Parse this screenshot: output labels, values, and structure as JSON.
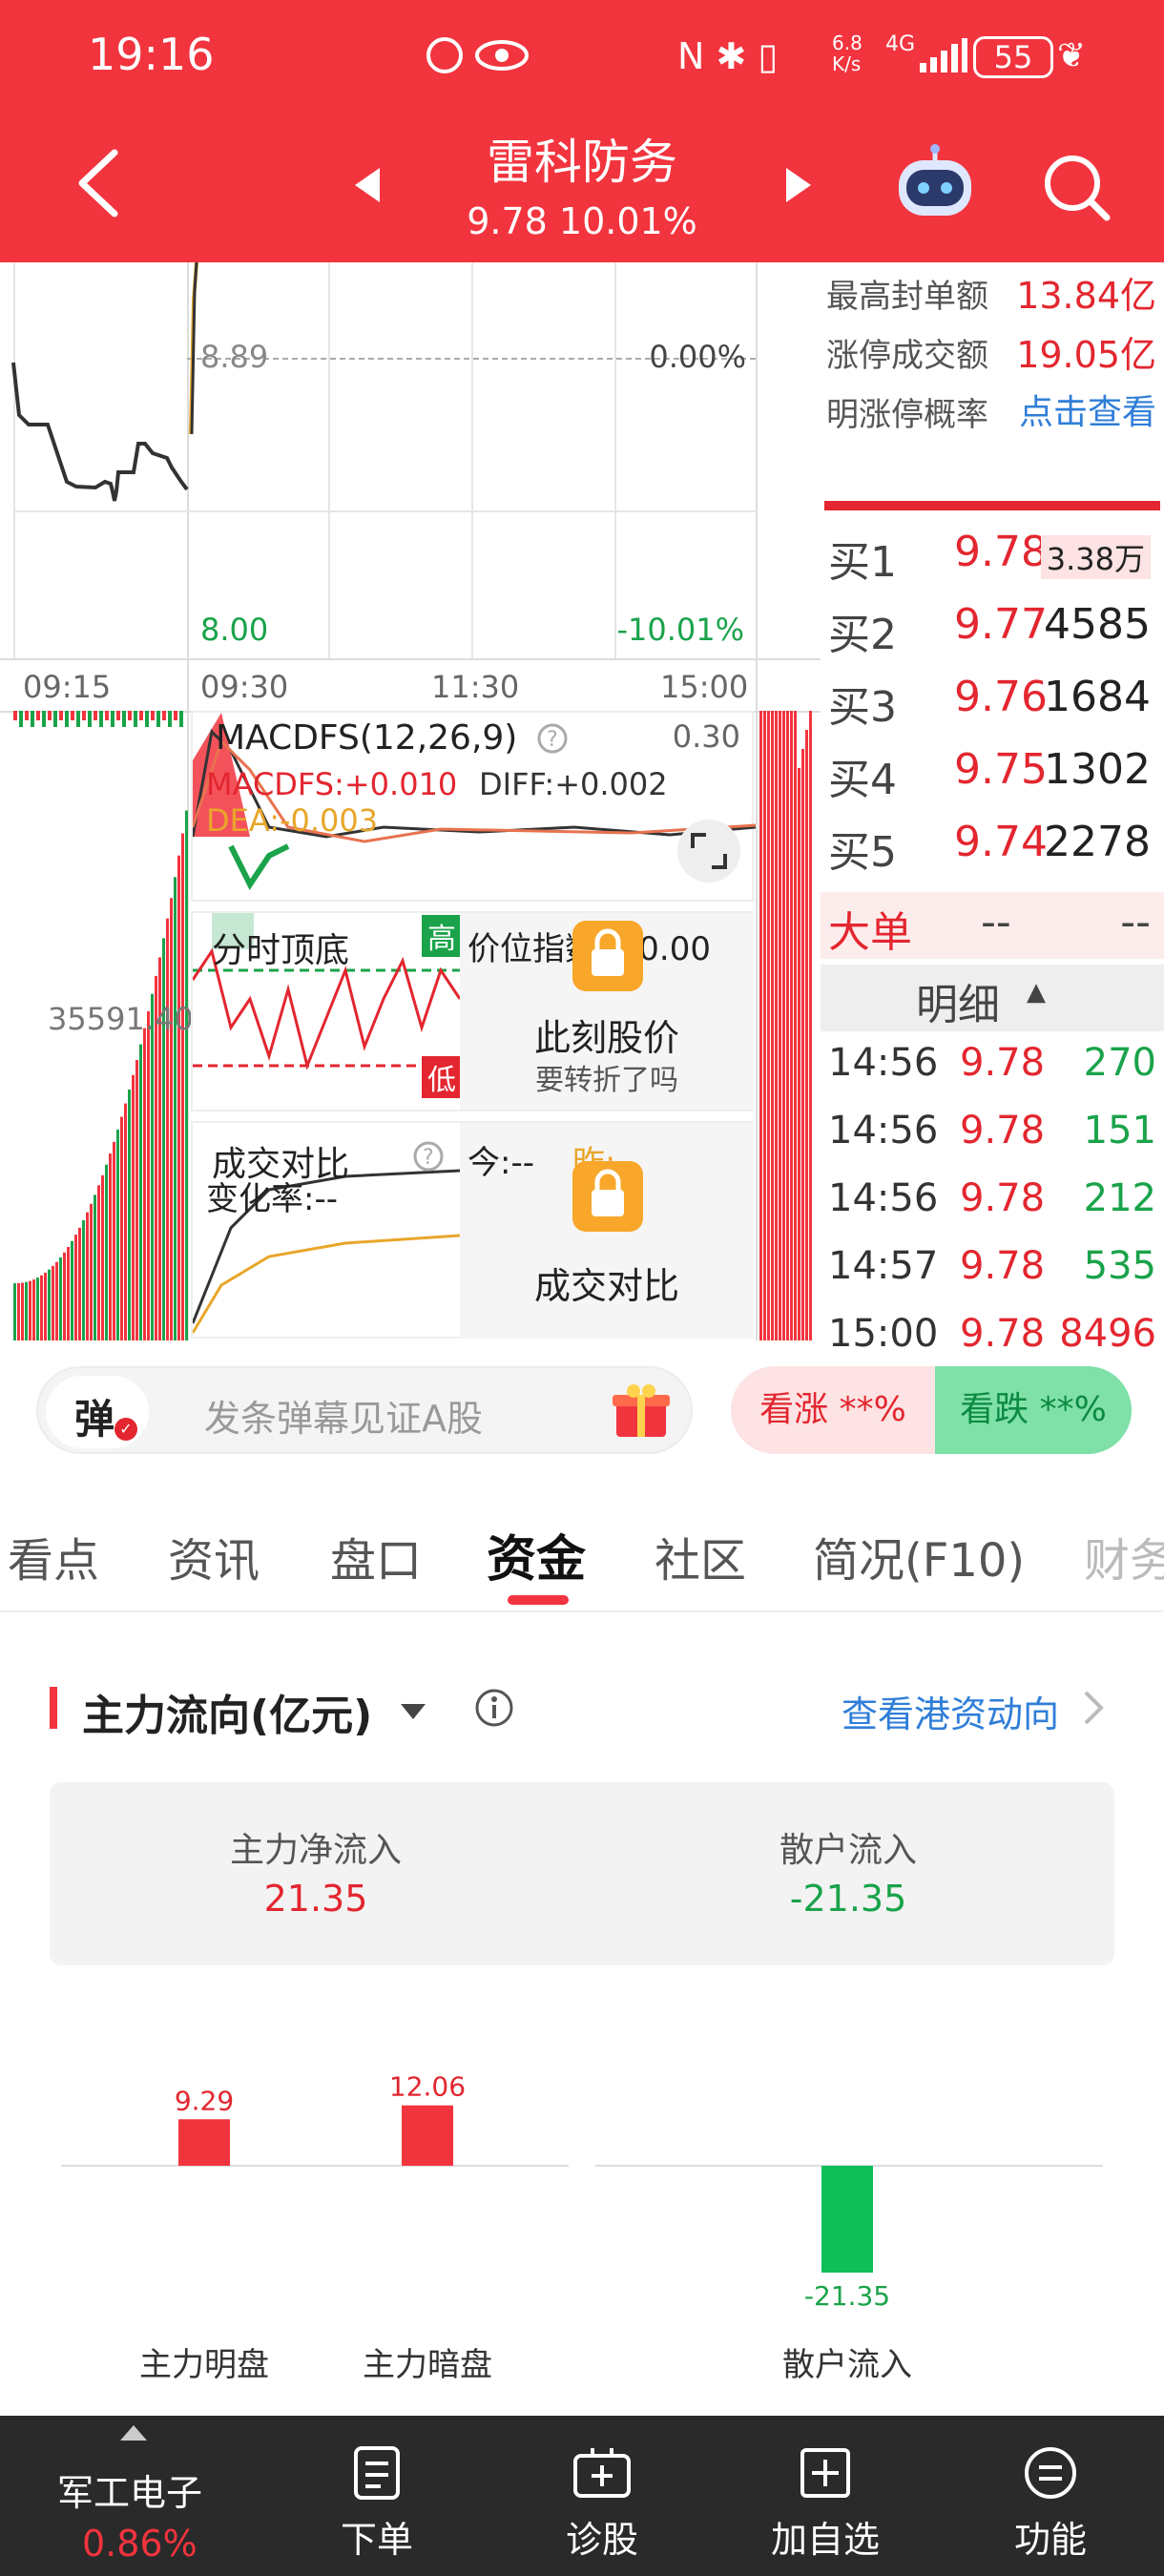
{
  "status_bar": {
    "time": "19:16",
    "net_speed": "6.8\nK/s",
    "network": "4G",
    "battery": "55"
  },
  "header": {
    "title": "雷科防务",
    "price": "9.78",
    "change_pct": "10.01%"
  },
  "chart": {
    "price_label": "8.89",
    "pct_label": "0.00%",
    "low_price": "8.00",
    "low_pct": "-10.01%",
    "time_labels": [
      "09:15",
      "09:30",
      "11:30",
      "15:00"
    ],
    "left_value": "35591.40",
    "macd": {
      "title": "MACDFS(12,26,9)",
      "max": "0.30",
      "macdfs": "MACDFS:+0.010",
      "diff": "DIFF:+0.002",
      "dea": "DEA:-0.003"
    },
    "top_bottom": {
      "title": "分时顶底",
      "high_tag": "高",
      "low_tag": "低",
      "price_index": "价位指数100.00",
      "promo_title": "此刻股价",
      "promo_sub": "要转折了吗"
    },
    "volume_compare": {
      "title": "成交对比",
      "today": "今:--",
      "yesterday": "昨:--",
      "change_rate": "变化率:--",
      "promo_title": "成交对比"
    }
  },
  "limit_info": [
    {
      "label": "最高封单额",
      "value": "13.84亿"
    },
    {
      "label": "涨停成交额",
      "value": "19.05亿"
    },
    {
      "label": "明涨停概率",
      "value": "点击查看"
    }
  ],
  "order_book": [
    {
      "label": "买1",
      "price": "9.78",
      "volume": "3.38万"
    },
    {
      "label": "买2",
      "price": "9.77",
      "volume": "4585"
    },
    {
      "label": "买3",
      "price": "9.76",
      "volume": "1684"
    },
    {
      "label": "买4",
      "price": "9.75",
      "volume": "1302"
    },
    {
      "label": "买5",
      "price": "9.74",
      "volume": "2278"
    }
  ],
  "big_order": {
    "label": "大单",
    "a": "--",
    "b": "--"
  },
  "detail": {
    "title": "明细",
    "ticks": [
      {
        "time": "14:56",
        "price": "9.78",
        "vol": "270",
        "color": "#1aa34a"
      },
      {
        "time": "14:56",
        "price": "9.78",
        "vol": "151",
        "color": "#1aa34a"
      },
      {
        "time": "14:56",
        "price": "9.78",
        "vol": "212",
        "color": "#1aa34a"
      },
      {
        "time": "14:57",
        "price": "9.78",
        "vol": "535",
        "color": "#1aa34a"
      },
      {
        "time": "15:00",
        "price": "9.78",
        "vol": "8496",
        "color": "#e3262f"
      }
    ]
  },
  "danmaku": {
    "icon_text": "弹",
    "placeholder": "发条弹幕见证A股",
    "bull": "看涨 **%",
    "bear": "看跌 **%"
  },
  "tabs": [
    "看点",
    "资讯",
    "盘口",
    "资金",
    "社区",
    "简况(F10)",
    "财务"
  ],
  "active_tab": "资金",
  "capital_flow": {
    "title": "主力流向(亿元)",
    "hk_link": "查看港资动向",
    "main_net_label": "主力净流入",
    "main_net_value": "21.35",
    "retail_label": "散户流入",
    "retail_value": "-21.35"
  },
  "chart_data": {
    "type": "bar",
    "categories": [
      "主力明盘",
      "主力暗盘",
      "散户流入"
    ],
    "values": [
      9.29,
      12.06,
      -21.35
    ],
    "value_labels": [
      "9.29",
      "12.06",
      "-21.35"
    ],
    "colors": [
      "#f2343e",
      "#f2343e",
      "#0fbf5a"
    ]
  },
  "bottom_bar": {
    "sector_name": "军工电子",
    "sector_change": "0.86%",
    "items": [
      "下单",
      "诊股",
      "加自选",
      "功能"
    ]
  },
  "colors": {
    "brand_red": "#f2343e",
    "up": "#e3262f",
    "down": "#1aa34a",
    "link": "#2f7ed8"
  }
}
